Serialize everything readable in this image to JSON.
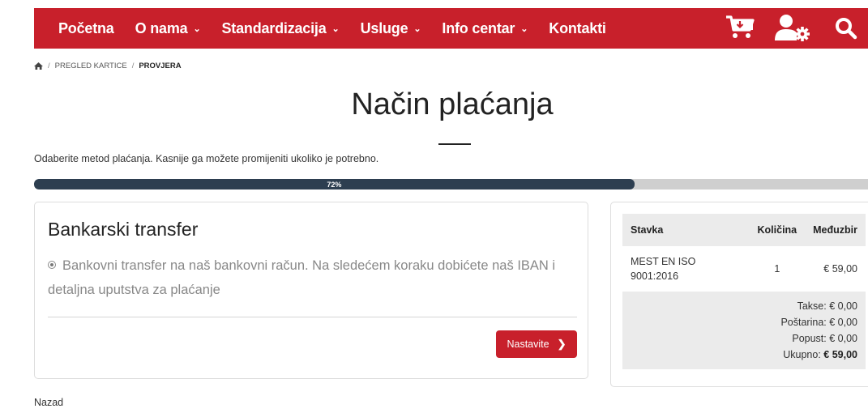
{
  "nav": {
    "items": [
      {
        "label": "Početna",
        "dropdown": false
      },
      {
        "label": "O nama",
        "dropdown": true
      },
      {
        "label": "Standardizacija",
        "dropdown": true
      },
      {
        "label": "Usluge",
        "dropdown": true
      },
      {
        "label": "Info centar",
        "dropdown": true
      },
      {
        "label": "Kontakti",
        "dropdown": false
      }
    ],
    "icons": [
      "cart-icon",
      "user-settings-icon",
      "search-icon"
    ],
    "brand_color": "#c8202b"
  },
  "breadcrumb": {
    "home_icon": "home-icon",
    "items": [
      "PREGLED KARTICE",
      "PROVJERA"
    ]
  },
  "page": {
    "title": "Način plaćanja",
    "subtitle": "Odaberite metod plaćanja. Kasnije ga možete promijeniti ukoliko je potrebno."
  },
  "progress": {
    "label": "72%",
    "fraction": 0.72
  },
  "payment": {
    "title": "Bankarski transfer",
    "option_text": "Bankovni transfer na naš bankovni račun. Na sledećem koraku dobićete naš IBAN i detaljna uputstva za plaćanje",
    "continue_label": "Nastavite"
  },
  "summary": {
    "headers": {
      "item": "Stavka",
      "qty": "Količina",
      "subtotal": "Međuzbir"
    },
    "rows": [
      {
        "item": "MEST EN ISO 9001:2016",
        "qty": "1",
        "subtotal": "€ 59,00"
      }
    ],
    "taxes": {
      "label": "Takse:",
      "value": "€ 0,00"
    },
    "shipping": {
      "label": "Poštarina:",
      "value": "€ 0,00"
    },
    "discount": {
      "label": "Popust:",
      "value": "€ 0,00"
    },
    "total": {
      "label": "Ukupno:",
      "value": "€ 59,00"
    }
  },
  "back_label": "Nazad"
}
